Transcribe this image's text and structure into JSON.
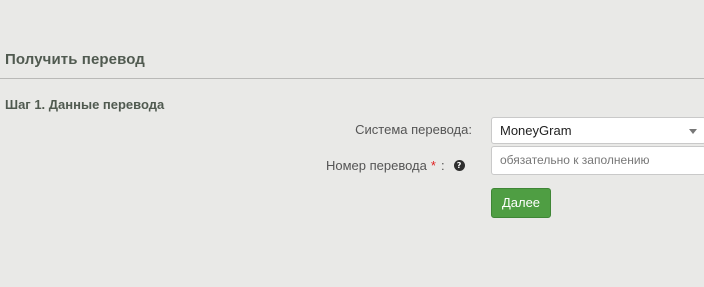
{
  "page_title": "Получить перевод",
  "step_title": "Шаг 1. Данные перевода",
  "form": {
    "system_label": "Система перевода:",
    "system_value": "MoneyGram",
    "number_label": "Номер перевода",
    "required_mark": "*",
    "colon": ":",
    "help_glyph": "?",
    "number_placeholder": "обязательно к заполнению",
    "submit_label": "Далее"
  },
  "colors": {
    "accent_button": "#4f9e43",
    "required": "#e02020"
  },
  "icons": {
    "help": "question-circle-icon",
    "dropdown": "chevron-down-icon"
  }
}
